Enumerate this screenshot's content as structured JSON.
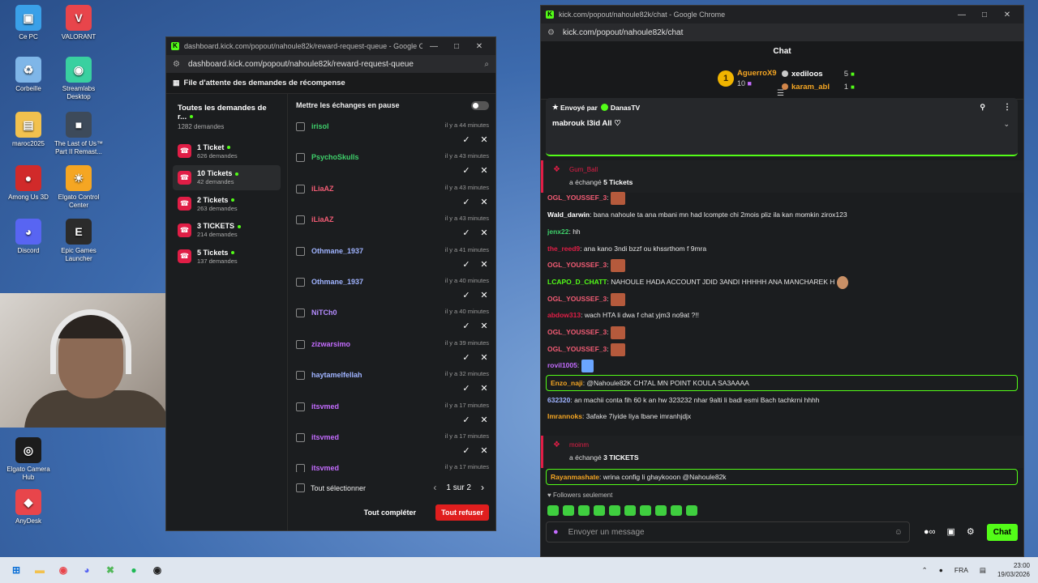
{
  "desktop": {
    "icons": [
      {
        "label": "Ce PC",
        "glyph": "▣",
        "color": "#3aa0e8"
      },
      {
        "label": "VALORANT",
        "glyph": "V",
        "color": "#e8454b"
      },
      {
        "label": "Corbeille",
        "glyph": "♻",
        "color": "#7fb6e8"
      },
      {
        "label": "Streamlabs Desktop",
        "glyph": "◉",
        "color": "#39d0a0"
      },
      {
        "label": "maroc2025",
        "glyph": "▤",
        "color": "#f2c14e"
      },
      {
        "label": "The Last of Us™ Part II Remast...",
        "glyph": "■",
        "color": "#3d4a5a"
      },
      {
        "label": "Among Us 3D",
        "glyph": "●",
        "color": "#d12a2a"
      },
      {
        "label": "Elgato Control Center",
        "glyph": "☀",
        "color": "#f5a623"
      },
      {
        "label": "Discord",
        "glyph": "◕",
        "color": "#5865f2"
      },
      {
        "label": "Epic Games Launcher",
        "glyph": "E",
        "color": "#2b2b2b"
      },
      {
        "label": "Elgato Camera Hub",
        "glyph": "◎",
        "color": "#1c1c1c"
      },
      {
        "label": "AnyDesk",
        "glyph": "◆",
        "color": "#e8454b"
      }
    ]
  },
  "reward_window": {
    "title": "dashboard.kick.com/popout/nahoule82k/reward-request-queue - Google Chrome",
    "url": "dashboard.kick.com/popout/nahoule82k/reward-request-queue",
    "header": "File d'attente des demandes de récompense",
    "all_rewards": {
      "name": "Toutes les demandes de r...",
      "count": "1282 demandes"
    },
    "rewards": [
      {
        "name": "1 Ticket",
        "count": "626 demandes"
      },
      {
        "name": "10 Tickets",
        "count": "42 demandes"
      },
      {
        "name": "2 Tickets",
        "count": "263 demandes"
      },
      {
        "name": "3 TICKETS",
        "count": "214 demandes"
      },
      {
        "name": "5 Tickets",
        "count": "137 demandes"
      }
    ],
    "pause_label": "Mettre les échanges en pause",
    "requests": [
      {
        "user": "irisol",
        "time": "il y a 44 minutes",
        "color": "#3fd16b"
      },
      {
        "user": "PsychoSkulls",
        "time": "il y a 43 minutes",
        "color": "#3fd16b"
      },
      {
        "user": "iLiaAZ",
        "time": "il y a 43 minutes",
        "color": "#f25c74"
      },
      {
        "user": "iLiaAZ",
        "time": "il y a 43 minutes",
        "color": "#f25c74"
      },
      {
        "user": "Othmane_1937",
        "time": "il y a 41 minutes",
        "color": "#9fb3ff"
      },
      {
        "user": "Othmane_1937",
        "time": "il y a 40 minutes",
        "color": "#9fb3ff"
      },
      {
        "user": "NiTCh0",
        "time": "il y a 40 minutes",
        "color": "#b58cff"
      },
      {
        "user": "zizwarsimo",
        "time": "il y a 39 minutes",
        "color": "#c46cff"
      },
      {
        "user": "haytamelfellah",
        "time": "il y a 32 minutes",
        "color": "#9fb3ff"
      },
      {
        "user": "itsvmed",
        "time": "il y a 17 minutes",
        "color": "#c46cff"
      },
      {
        "user": "itsvmed",
        "time": "il y a 17 minutes",
        "color": "#c46cff"
      },
      {
        "user": "itsvmed",
        "time": "il y a 17 minutes",
        "color": "#c46cff"
      }
    ],
    "select_all": "Tout sélectionner",
    "page": "1 sur 2",
    "complete_all": "Tout compléter",
    "refuse_all": "Tout refuser"
  },
  "chat_window": {
    "title": "kick.com/popout/nahoule82k/chat - Google Chrome",
    "url": "kick.com/popout/nahoule82k/chat",
    "header": "Chat",
    "leaderboard": {
      "first": {
        "rank": "1",
        "name": "AguerroX9",
        "score": "10"
      },
      "others": [
        {
          "name": "xediloos",
          "score": "5",
          "color": "#ffffff",
          "medal": "#c9c9c9"
        },
        {
          "name": "karam_abl",
          "score": "1",
          "color": "#f5a623",
          "medal": "#d2864a"
        }
      ]
    },
    "pinned": {
      "sent_by": "Envoyé par",
      "author": "DanasTV",
      "message": "mabrouk l3id All ♡"
    },
    "redeem1": {
      "user": "Gum_Ball",
      "prefix": "a échangé",
      "reward": "5 Tickets"
    },
    "messages": [
      {
        "user": "OGL_YOUSSEF_3",
        "color": "#f25c74",
        "text": ":",
        "emote": "pic"
      },
      {
        "user": "Wald_darwin",
        "color": "#ffffff",
        "text": ": bana nahoule ta ana mbani mn had lcompte chi 2mois pliz ila kan momkin zirox123"
      },
      {
        "user": "jenx22",
        "color": "#3fd16b",
        "text": ": hh"
      },
      {
        "user": "the_reed9",
        "color": "#e01e46",
        "text": ": ana kano 3ndi bzzf ou khssrthom f 9mra"
      },
      {
        "user": "OGL_YOUSSEF_3",
        "color": "#f25c74",
        "text": ":",
        "emote": "pic"
      },
      {
        "user": "LCAPO_D_CHATT",
        "color": "#53fc18",
        "text": ": NAHOULE HADA ACCOUNT JDID 3ANDI HHHHH ANA MANCHAREK H",
        "emote": "face"
      },
      {
        "user": "OGL_YOUSSEF_3",
        "color": "#f25c74",
        "text": ":",
        "emote": "pic"
      },
      {
        "user": "abdow313",
        "color": "#e01e46",
        "text": ": wach HTA li dwa f chat yjm3 no9at ?!!"
      },
      {
        "user": "OGL_YOUSSEF_3",
        "color": "#f25c74",
        "text": ":",
        "emote": "pic"
      },
      {
        "user": "OGL_YOUSSEF_3",
        "color": "#f25c74",
        "text": ":",
        "emote": "pic"
      },
      {
        "user": "rovil1005",
        "color": "#c46cff",
        "text": ":",
        "emote": "blue"
      },
      {
        "user": "Enzo_naji",
        "color": "#f5a623",
        "text": ": @Nahoule82K CH7AL MN POINT KOULA SA3AAAA",
        "highlight": true
      },
      {
        "user": "632320",
        "color": "#9fb3ff",
        "text": ": an machii conta fih 60 k an hw 323232 nhar 9alti li badi esmi Bach tachkrni hhhh"
      },
      {
        "user": "Imrannoks",
        "color": "#f5a623",
        "text": ": 3afake 7iyide liya lbane imranhjdjx"
      }
    ],
    "redeem2": {
      "user": "moinm",
      "prefix": "a échangé",
      "reward": "3 TICKETS"
    },
    "last_message": {
      "user": "Rayanmashate",
      "color": "#f5a623",
      "text": ": wrina config li ghaykooon @Nahoule82k"
    },
    "followers_only": "Followers seulement",
    "input_placeholder": "Envoyer un message",
    "send": "Chat"
  },
  "taskbar": {
    "apps": [
      {
        "glyph": "⊞",
        "color": "#0a6fd6"
      },
      {
        "glyph": "▬",
        "color": "#f2c14e"
      },
      {
        "glyph": "◉",
        "color": "#e8454b"
      },
      {
        "glyph": "◕",
        "color": "#5865f2"
      },
      {
        "glyph": "✖",
        "color": "#53b85a"
      },
      {
        "glyph": "●",
        "color": "#1db954"
      },
      {
        "glyph": "◉",
        "color": "#222222"
      }
    ],
    "lang": "FRA",
    "time": "23:00",
    "date": "19/03/2026"
  }
}
